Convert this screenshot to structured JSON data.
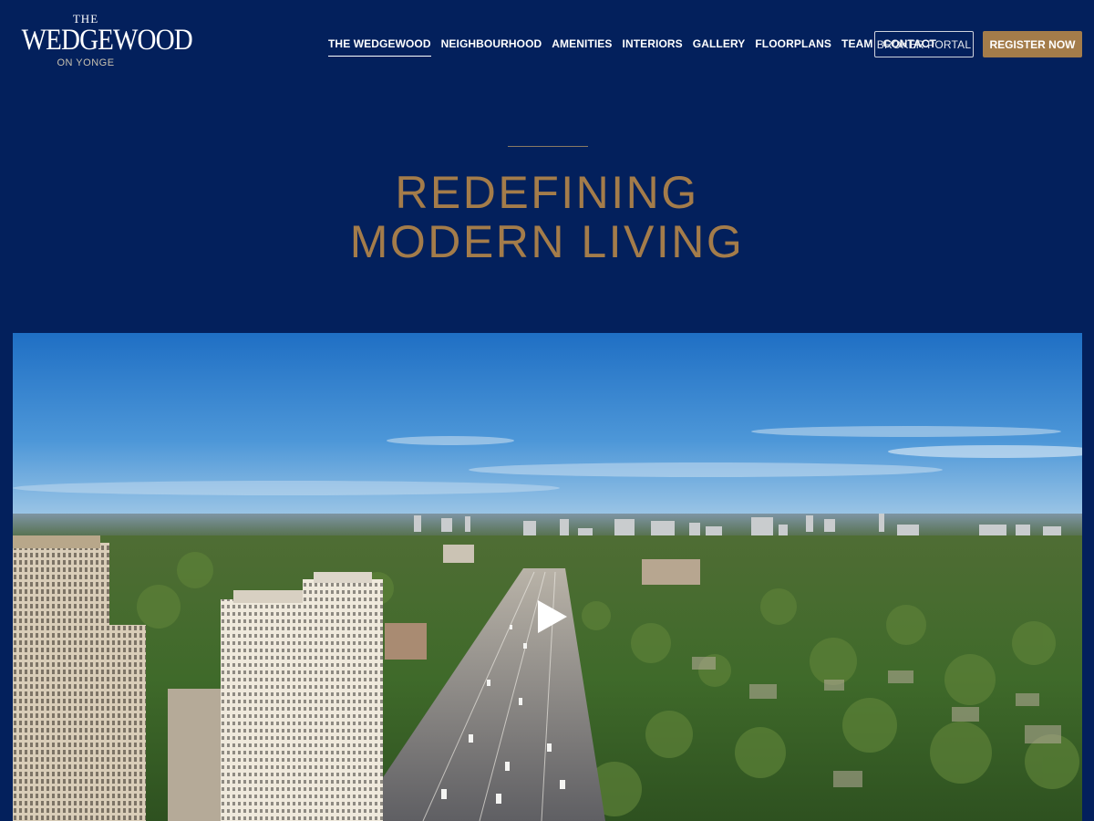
{
  "logo": {
    "top": "THE",
    "main": "WEDGEWOOD",
    "sub": "ON YONGE"
  },
  "nav": {
    "items": [
      {
        "label": "THE WEDGEWOOD",
        "active": true
      },
      {
        "label": "NEIGHBOURHOOD"
      },
      {
        "label": "AMENITIES"
      },
      {
        "label": "INTERIORS"
      },
      {
        "label": "GALLERY"
      },
      {
        "label": "FLOORPLANS"
      },
      {
        "label": "TEAM"
      },
      {
        "label": "CONTACT"
      }
    ],
    "broker_label": "BROKER PORTAL",
    "register_label": "REGISTER NOW"
  },
  "hero": {
    "line1": "REDEFINING",
    "line2": "MODERN LIVING"
  },
  "video": {
    "icon": "play-icon"
  },
  "colors": {
    "background": "#03205c",
    "accent": "#a47c4a"
  }
}
